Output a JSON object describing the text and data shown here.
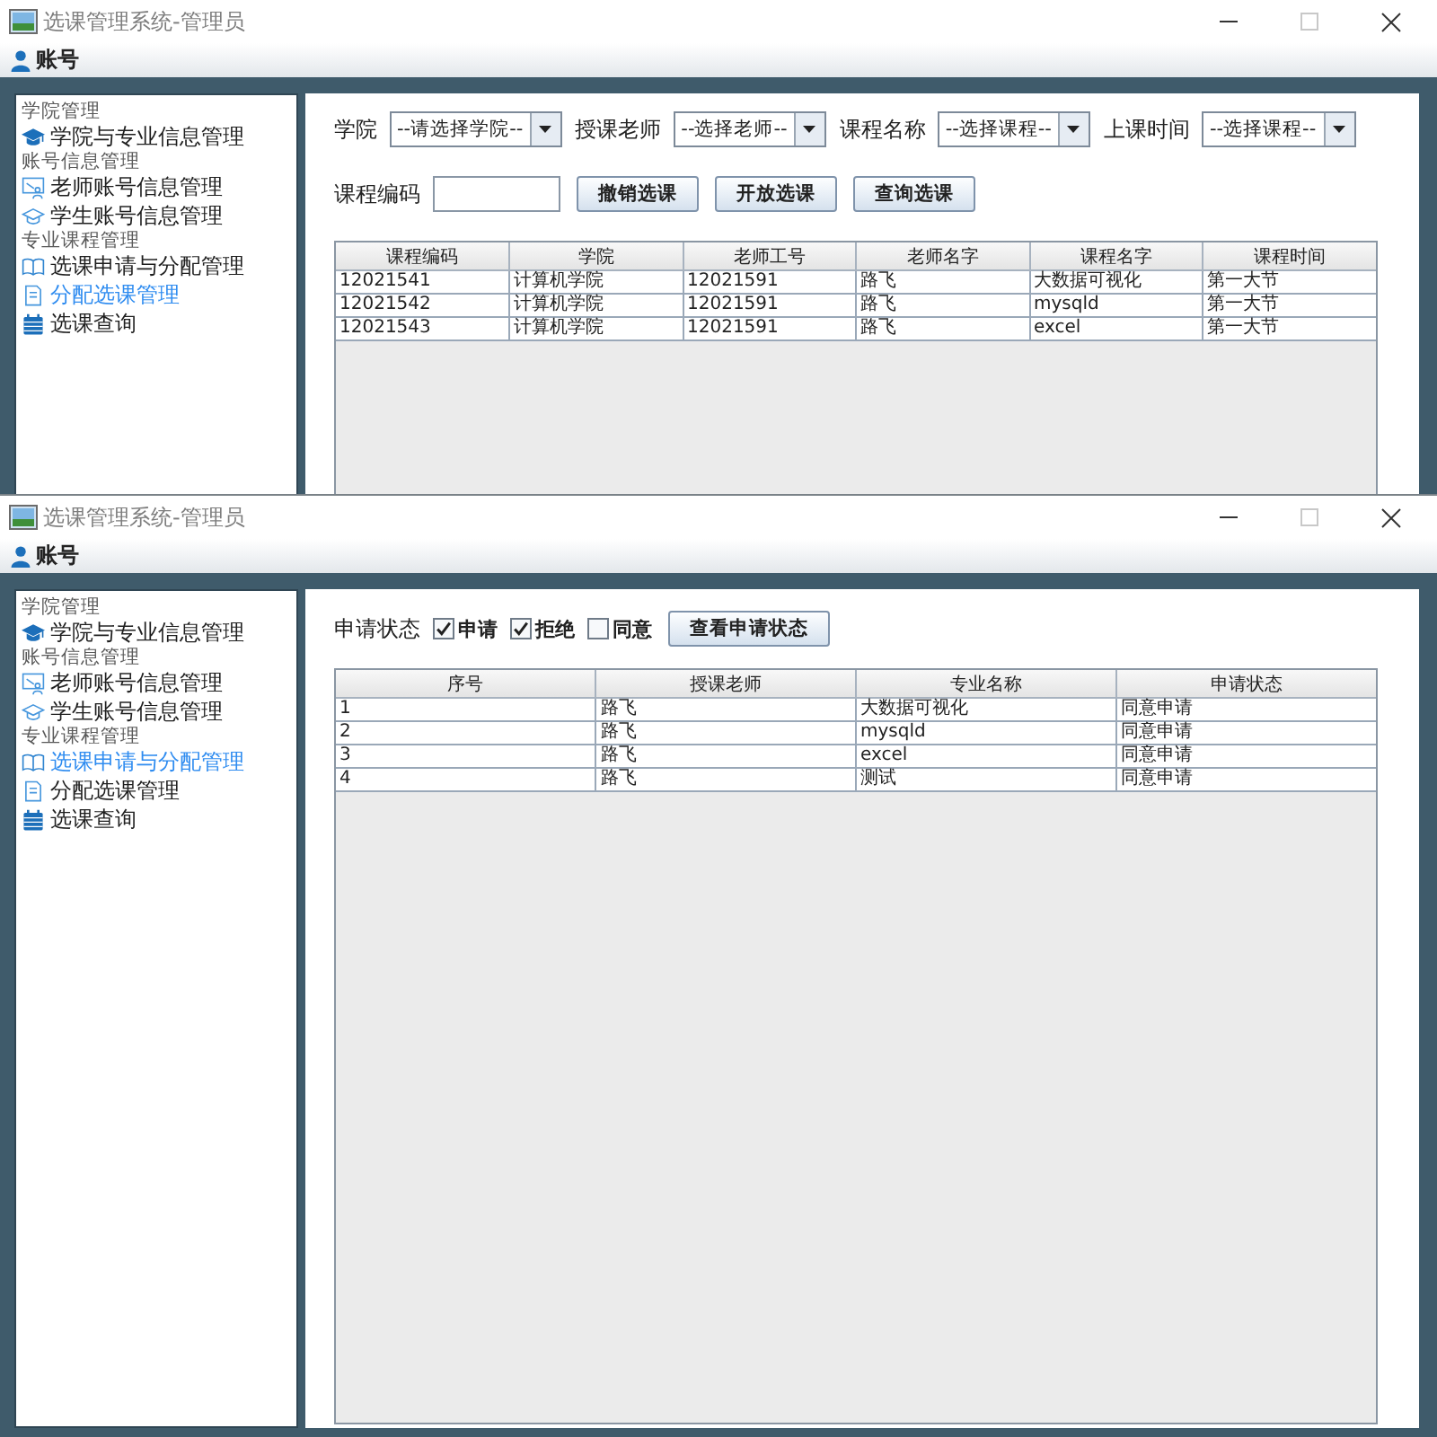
{
  "windows": [
    {
      "title": "选课管理系统-管理员",
      "maximize_disabled": true,
      "menu": [
        {
          "label": "账号"
        }
      ],
      "sidebar": [
        {
          "title": "学院管理",
          "items": [
            {
              "label": "学院与专业信息管理",
              "selected": false
            }
          ]
        },
        {
          "title": "账号信息管理",
          "items": [
            {
              "label": "老师账号信息管理",
              "selected": false
            },
            {
              "label": "学生账号信息管理",
              "selected": false
            }
          ]
        },
        {
          "title": "专业课程管理",
          "items": [
            {
              "label": "选课申请与分配管理",
              "selected": false
            },
            {
              "label": "分配选课管理",
              "selected": true
            },
            {
              "label": "选课查询",
              "selected": false
            }
          ]
        }
      ],
      "toolbar_rows": [
        [
          {
            "kind": "label",
            "text": "学院"
          },
          {
            "kind": "combo",
            "value": "--请选择学院--"
          },
          {
            "kind": "label",
            "text": "授课老师"
          },
          {
            "kind": "combo",
            "value": "--选择老师--"
          },
          {
            "kind": "label",
            "text": "课程名称"
          },
          {
            "kind": "combo",
            "value": "--选择课程--"
          },
          {
            "kind": "label",
            "text": "上课时间"
          },
          {
            "kind": "combo",
            "value": "--选择课程--"
          }
        ],
        [
          {
            "kind": "label",
            "text": "课程编码"
          },
          {
            "kind": "input"
          },
          {
            "kind": "button",
            "label": "撤销选课"
          },
          {
            "kind": "button",
            "label": "开放选课"
          },
          {
            "kind": "button",
            "label": "查询选课"
          }
        ]
      ],
      "table": {
        "columns": [
          "课程编码",
          "学院",
          "老师工号",
          "老师名字",
          "课程名字",
          "课程时间"
        ],
        "rows": [
          [
            "12021541",
            "计算机学院",
            "12021591",
            "路飞",
            "大数据可视化",
            "第一大节"
          ],
          [
            "12021542",
            "计算机学院",
            "12021591",
            "路飞",
            "mysqld",
            "第一大节"
          ],
          [
            "12021543",
            "计算机学院",
            "12021591",
            "路飞",
            "excel",
            "第一大节"
          ]
        ]
      }
    },
    {
      "title": "选课管理系统-管理员",
      "maximize_disabled": true,
      "menu": [
        {
          "label": "账号"
        }
      ],
      "sidebar": [
        {
          "title": "学院管理",
          "items": [
            {
              "label": "学院与专业信息管理",
              "selected": false
            }
          ]
        },
        {
          "title": "账号信息管理",
          "items": [
            {
              "label": "老师账号信息管理",
              "selected": false
            },
            {
              "label": "学生账号信息管理",
              "selected": false
            }
          ]
        },
        {
          "title": "专业课程管理",
          "items": [
            {
              "label": "选课申请与分配管理",
              "selected": true
            },
            {
              "label": "分配选课管理",
              "selected": false
            },
            {
              "label": "选课查询",
              "selected": false
            }
          ]
        }
      ],
      "toolbar_rows": [
        [
          {
            "kind": "label",
            "text": "申请状态"
          },
          {
            "kind": "checkbox",
            "label": "申请",
            "checked": true
          },
          {
            "kind": "checkbox",
            "label": "拒绝",
            "checked": true
          },
          {
            "kind": "checkbox",
            "label": "同意",
            "checked": false
          },
          {
            "kind": "button",
            "label": "查看申请状态"
          }
        ]
      ],
      "table": {
        "columns": [
          "序号",
          "授课老师",
          "专业名称",
          "申请状态"
        ],
        "rows": [
          [
            "1",
            "路飞",
            "大数据可视化",
            "同意申请"
          ],
          [
            "2",
            "路飞",
            "mysqld",
            "同意申请"
          ],
          [
            "3",
            "路飞",
            "excel",
            "同意申请"
          ],
          [
            "4",
            "路飞",
            "测试",
            "同意申请"
          ]
        ]
      }
    }
  ]
}
